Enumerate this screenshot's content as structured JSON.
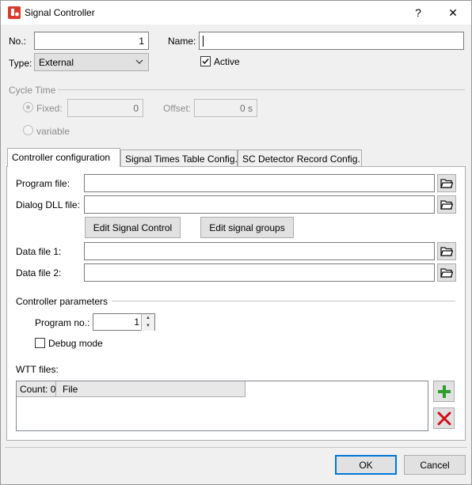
{
  "window": {
    "title": "Signal Controller",
    "help": "?",
    "close": "✕"
  },
  "header": {
    "no_label": "No.:",
    "no_value": "1",
    "name_label": "Name:",
    "name_value": "",
    "type_label": "Type:",
    "type_value": "External",
    "active_label": "Active",
    "active_checked": true
  },
  "cycle": {
    "section_label": "Cycle Time",
    "fixed_label": "Fixed:",
    "fixed_value": "0",
    "offset_label": "Offset:",
    "offset_value": "0 s",
    "variable_label": "variable"
  },
  "tabs": [
    {
      "label": "Controller configuration",
      "active": true
    },
    {
      "label": "Signal Times Table Config.",
      "active": false
    },
    {
      "label": "SC Detector Record Config.",
      "active": false
    }
  ],
  "config": {
    "program_file_label": "Program file:",
    "program_file_value": "",
    "dialog_dll_label": "Dialog DLL file:",
    "dialog_dll_value": "",
    "edit_signal_control": "Edit Signal Control",
    "edit_signal_groups": "Edit signal groups",
    "data_file1_label": "Data file 1:",
    "data_file1_value": "",
    "data_file2_label": "Data file 2:",
    "data_file2_value": "",
    "controller_params_label": "Controller parameters",
    "program_no_label": "Program no.:",
    "program_no_value": "1",
    "debug_mode_label": "Debug mode",
    "wtt_files_label": "WTT files:",
    "wtt_count_header": "Count: 0",
    "wtt_file_header": "File"
  },
  "footer": {
    "ok": "OK",
    "cancel": "Cancel"
  },
  "colors": {
    "accent": "#0078d7",
    "add_green": "#2e9e2e",
    "delete_red": "#d0101a",
    "app_icon": "#d83b2b"
  }
}
